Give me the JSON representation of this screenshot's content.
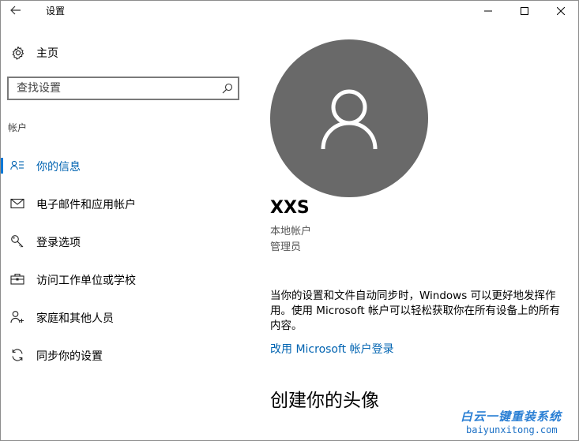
{
  "window": {
    "title": "设置"
  },
  "sidebar": {
    "home_label": "主页",
    "search_placeholder": "查找设置",
    "section_label": "帐户",
    "items": [
      {
        "label": "你的信息",
        "icon": "person-info-icon",
        "active": true
      },
      {
        "label": "电子邮件和应用帐户",
        "icon": "mail-icon"
      },
      {
        "label": "登录选项",
        "icon": "key-icon"
      },
      {
        "label": "访问工作单位或学校",
        "icon": "briefcase-icon"
      },
      {
        "label": "家庭和其他人员",
        "icon": "add-person-icon"
      },
      {
        "label": "同步你的设置",
        "icon": "sync-icon"
      }
    ]
  },
  "main": {
    "username": "XXS",
    "account_type": "本地帐户",
    "role": "管理员",
    "description": "当你的设置和文件自动同步时，Windows 可以更好地发挥作用。使用 Microsoft 帐户可以轻松获取你在所有设备上的所有内容。",
    "microsoft_link": "改用 Microsoft 帐户登录",
    "avatar_heading": "创建你的头像"
  },
  "watermark": {
    "line1": "白云一键重装系统",
    "line2": "baiyunxitong.com"
  },
  "colors": {
    "accent": "#0078d7",
    "link": "#0063b1",
    "avatar_bg": "#696969"
  }
}
